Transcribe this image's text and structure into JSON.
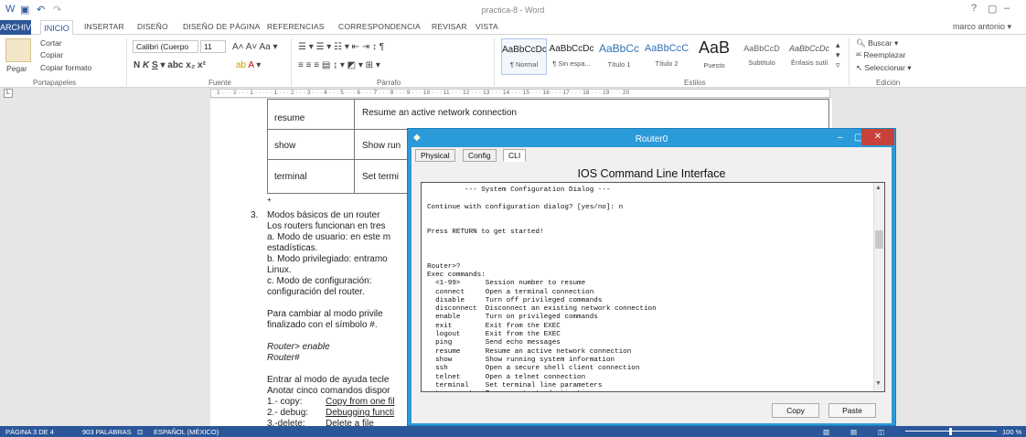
{
  "titlebar": {
    "title": "practica-8 - Word",
    "help": "?",
    "restore": "▢",
    "minimize": "–",
    "close": "✕"
  },
  "tabs": {
    "archivo": "ARCHIVO",
    "inicio": "INICIO",
    "others": [
      "INSERTAR",
      "DISEÑO",
      "DISEÑO DE PÁGINA",
      "REFERENCIAS",
      "CORRESPONDENCIA",
      "REVISAR",
      "VISTA"
    ],
    "user": "marco antonio ▾"
  },
  "ribbon": {
    "clipboard": {
      "paste": "Pegar",
      "cut": "Cortar",
      "copy": "Copiar",
      "format": "Copiar formato",
      "label": "Portapapeles"
    },
    "font": {
      "name": "Calibri (Cuerpo",
      "size": "11",
      "label": "Fuente"
    },
    "paragraph": {
      "label": "Párrafo"
    },
    "styles": {
      "label": "Estilos",
      "items": [
        {
          "prev": "AaBbCcDc",
          "name": "¶ Normal"
        },
        {
          "prev": "AaBbCcDc",
          "name": "¶ Sin espa..."
        },
        {
          "prev": "AaBbCc",
          "name": "Título 1"
        },
        {
          "prev": "AaBbCcC",
          "name": "Título 2"
        },
        {
          "prev": "AaB",
          "name": "Puesto"
        },
        {
          "prev": "AaBbCcD",
          "name": "Subtítulo"
        },
        {
          "prev": "AaBbCcDc",
          "name": "Énfasis sutil"
        }
      ]
    },
    "editing": {
      "find": "Buscar",
      "replace": "Reemplazar",
      "select": "Seleccionar",
      "label": "Edición"
    }
  },
  "ruler": {
    "text": "1 · · · 2 · · · 1 · · · · · 1 · · · 2 · · · 3 · · · 4 · · · 5 · · · 6 · · · 7 · · · 8 · · · 9 · · · 10 · · · 11 · · · 12 · · · 13 · · · 14 · · · 15 · · · 16 · · · 17 · · · 18 · · · 19 · · · 20"
  },
  "document": {
    "table": [
      {
        "cmd": "resume",
        "desc": "Resume an active network connection"
      },
      {
        "cmd": "show",
        "desc": "Show run"
      },
      {
        "cmd": "terminal",
        "desc": "Set termi"
      }
    ],
    "plus": "+",
    "section_num": "3.",
    "section_title": "Modos básicos de un router",
    "lines": [
      "Los routers funcionan en tres",
      "a. Modo de usuario: en este m",
      "estadísticas.",
      "b. Modo privilegiado: entramo",
      "Linux.",
      "c. Modo de configuración:",
      "configuración del router."
    ],
    "para2": [
      "Para cambiar al modo privile",
      "finalizado con el símbolo #."
    ],
    "prompt1": "Router> enable",
    "prompt2": "Router#",
    "para3": [
      "Entrar al modo de ayuda tecle",
      "Anotar cinco comandos dispor"
    ],
    "list": [
      {
        "n": "1.- copy:",
        "t": "Copy from one fil"
      },
      {
        "n": "2.- debug:",
        "t": "Debugging functi"
      },
      {
        "n": "3.-delete:",
        "t": "Delete a file"
      }
    ]
  },
  "status": {
    "page": "PÁGINA 3 DE 4",
    "words": "903 PALABRAS",
    "lang": "ESPAÑOL (MÉXICO)",
    "zoom": "100 %"
  },
  "router": {
    "title": "Router0",
    "tabs": [
      "Physical",
      "Config",
      "CLI"
    ],
    "heading": "IOS Command Line Interface",
    "cli": "         --- System Configuration Dialog ---\n\nContinue with configuration dialog? [yes/no]: n\n\n\nPress RETURN to get started!\n\n\n\nRouter>?\nExec commands:\n  <1-99>      Session number to resume\n  connect     Open a terminal connection\n  disable     Turn off privileged commands\n  disconnect  Disconnect an existing network connection\n  enable      Turn on privileged commands\n  exit        Exit from the EXEC\n  logout      Exit from the EXEC\n  ping        Send echo messages\n  resume      Resume an active network connection\n  show        Show running system information\n  ssh         Open a secure shell client connection\n  telnet      Open a telnet connection\n  terminal    Set terminal line parameters\n  traceroute  Trace route to destination",
    "copy": "Copy",
    "paste": "Paste",
    "minimize": "–",
    "restore": "▢",
    "close": "✕"
  }
}
